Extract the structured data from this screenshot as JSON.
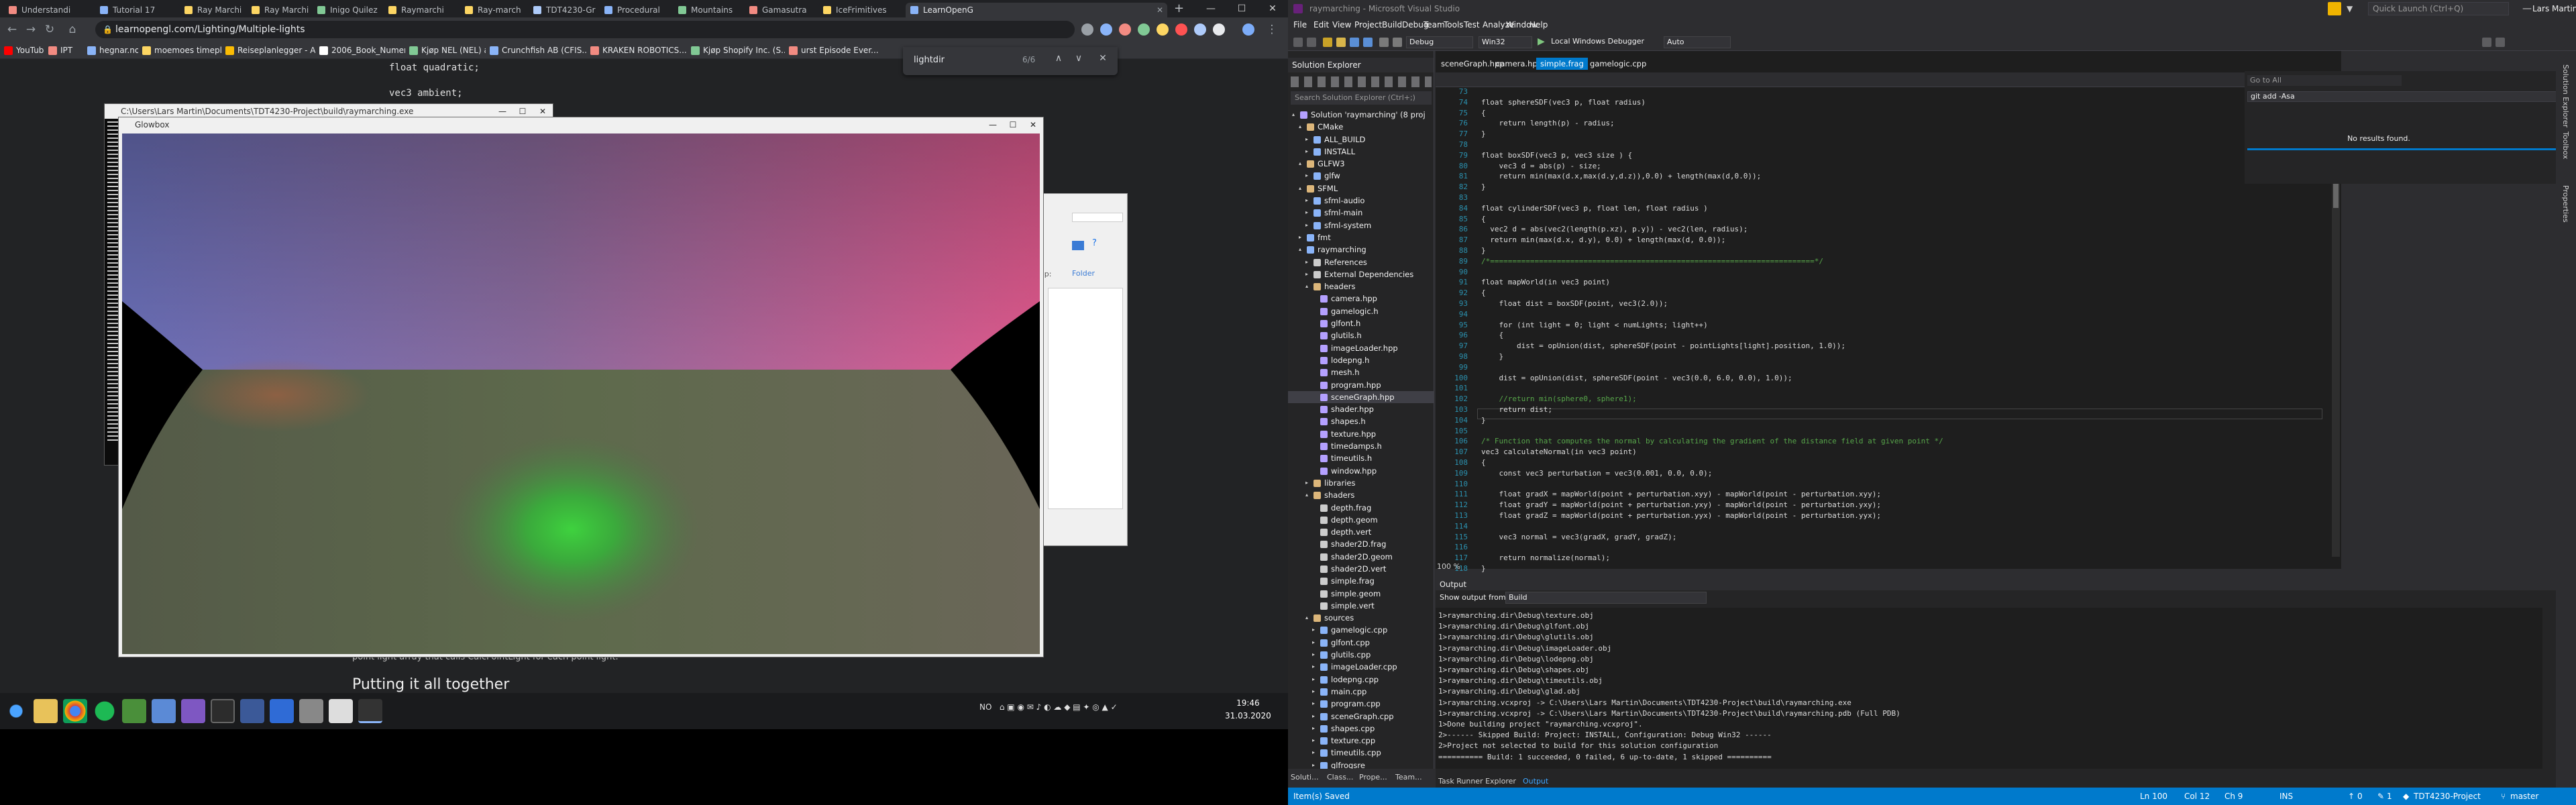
{
  "browser": {
    "tabs": [
      {
        "label": "Understandi",
        "color": "#f28b82"
      },
      {
        "label": "Tutorial 17",
        "color": "#8ab4f8"
      },
      {
        "label": "Ray Marchi",
        "color": "#fdd663"
      },
      {
        "label": "Ray Marchi",
        "color": "#fdd663"
      },
      {
        "label": "Inigo Quilez",
        "color": "#81c995"
      },
      {
        "label": "Raymarchi",
        "color": "#fdd663"
      },
      {
        "label": "Ray-march",
        "color": "#fdd663"
      },
      {
        "label": "TDT4230-Gr",
        "color": "#aecbfa"
      },
      {
        "label": "Procedural",
        "color": "#8ab4f8"
      },
      {
        "label": "Mountains",
        "color": "#81c995"
      },
      {
        "label": "Gamasutra",
        "color": "#f28b82"
      },
      {
        "label": "IceFrimitives",
        "color": "#fdd663"
      },
      {
        "label": "LearnOpenG",
        "color": "#8ab4f8"
      }
    ],
    "new_tab": "+",
    "url": "learnopengl.com/Lighting/Multiple-lights",
    "bookmarks": [
      {
        "label": "YouTube",
        "color": "#ff0000"
      },
      {
        "label": "IPT",
        "color": "#f28b82"
      },
      {
        "label": "hegnar.no",
        "color": "#8ab4f8"
      },
      {
        "label": "moemoes timeplan...",
        "color": "#fdd663"
      },
      {
        "label": "Reiseplanlegger - A...",
        "color": "#fbbc04"
      },
      {
        "label": "2006_Book_Numeri...",
        "color": "#ffffff"
      },
      {
        "label": "Kjøp NEL (NEL) aksj...",
        "color": "#81c995"
      },
      {
        "label": "Crunchfish AB (CFIS...",
        "color": "#8ab4f8"
      },
      {
        "label": "KRAKEN ROBOTICS...",
        "color": "#f28b82"
      },
      {
        "label": "Kjøp Shopify Inc. (S...",
        "color": "#81c995"
      },
      {
        "label": "urst Episode Ever...",
        "color": "#f28b82"
      }
    ],
    "find": {
      "query": "lightdir",
      "count": "6/6"
    },
    "page": {
      "snippet1": "float quadratic;",
      "snippet2": "vec3 ambient;",
      "para": "point light array that calls CalcPointLight for each point light.",
      "heading": "Putting it all together"
    }
  },
  "windows": {
    "console_title": "C:\\Users\\Lars Martin\\Documents\\TDT4230-Project\\build\\raymarching.exe",
    "glfw_title": "Glowbox"
  },
  "explorer": {
    "folder": "Folder"
  },
  "taskbar": {
    "tray_lang": "NO",
    "time": "19:46",
    "date": "31.03.2020"
  },
  "vs": {
    "title": "raymarching - Microsoft Visual Studio",
    "menu": [
      "File",
      "Edit",
      "View",
      "Project",
      "Build",
      "Debug",
      "Team",
      "Tools",
      "Test",
      "Analyze",
      "Window",
      "Help"
    ],
    "toolbar": {
      "config": "Debug",
      "platform": "Win32",
      "debugger": "Local Windows Debugger",
      "mode": "Auto"
    },
    "quick_launch": "Quick Launch (Ctrl+Q)",
    "user": "Lars Martin Moe",
    "solution_explorer": {
      "title": "Solution Explorer",
      "search": "Search Solution Explorer (Ctrl+;)",
      "items": [
        {
          "label": "Solution 'raymarching' (8 proj",
          "indent": 0,
          "arrow": "▴",
          "color": "#b4a0ff"
        },
        {
          "label": "CMake",
          "indent": 1,
          "arrow": "▴",
          "color": "#dcb67a"
        },
        {
          "label": "ALL_BUILD",
          "indent": 2,
          "arrow": "▸",
          "color": "#8ab4f8"
        },
        {
          "label": "INSTALL",
          "indent": 2,
          "arrow": "▸",
          "color": "#8ab4f8"
        },
        {
          "label": "GLFW3",
          "indent": 1,
          "arrow": "▴",
          "color": "#dcb67a"
        },
        {
          "label": "glfw",
          "indent": 2,
          "arrow": "▸",
          "color": "#8ab4f8"
        },
        {
          "label": "SFML",
          "indent": 1,
          "arrow": "▴",
          "color": "#dcb67a"
        },
        {
          "label": "sfml-audio",
          "indent": 2,
          "arrow": "▸",
          "color": "#8ab4f8"
        },
        {
          "label": "sfml-main",
          "indent": 2,
          "arrow": "▸",
          "color": "#8ab4f8"
        },
        {
          "label": "sfml-system",
          "indent": 2,
          "arrow": "▸",
          "color": "#8ab4f8"
        },
        {
          "label": "fmt",
          "indent": 1,
          "arrow": "▸",
          "color": "#8ab4f8"
        },
        {
          "label": "raymarching",
          "indent": 1,
          "arrow": "▴",
          "color": "#8ab4f8"
        },
        {
          "label": "References",
          "indent": 2,
          "arrow": "▸",
          "color": "#cccccc"
        },
        {
          "label": "External Dependencies",
          "indent": 2,
          "arrow": "▸",
          "color": "#cccccc"
        },
        {
          "label": "headers",
          "indent": 2,
          "arrow": "▴",
          "color": "#dcb67a"
        },
        {
          "label": "camera.hpp",
          "indent": 3,
          "arrow": "",
          "color": "#b4a0ff"
        },
        {
          "label": "gamelogic.h",
          "indent": 3,
          "arrow": "",
          "color": "#b4a0ff"
        },
        {
          "label": "glfont.h",
          "indent": 3,
          "arrow": "",
          "color": "#b4a0ff"
        },
        {
          "label": "glutils.h",
          "indent": 3,
          "arrow": "",
          "color": "#b4a0ff"
        },
        {
          "label": "imageLoader.hpp",
          "indent": 3,
          "arrow": "",
          "color": "#b4a0ff"
        },
        {
          "label": "lodepng.h",
          "indent": 3,
          "arrow": "",
          "color": "#b4a0ff"
        },
        {
          "label": "mesh.h",
          "indent": 3,
          "arrow": "",
          "color": "#b4a0ff"
        },
        {
          "label": "program.hpp",
          "indent": 3,
          "arrow": "",
          "color": "#b4a0ff"
        },
        {
          "label": "sceneGraph.hpp",
          "indent": 3,
          "arrow": "",
          "color": "#b4a0ff",
          "selected": true
        },
        {
          "label": "shader.hpp",
          "indent": 3,
          "arrow": "",
          "color": "#b4a0ff"
        },
        {
          "label": "shapes.h",
          "indent": 3,
          "arrow": "",
          "color": "#b4a0ff"
        },
        {
          "label": "texture.hpp",
          "indent": 3,
          "arrow": "",
          "color": "#b4a0ff"
        },
        {
          "label": "timedamps.h",
          "indent": 3,
          "arrow": "",
          "color": "#b4a0ff"
        },
        {
          "label": "timeutils.h",
          "indent": 3,
          "arrow": "",
          "color": "#b4a0ff"
        },
        {
          "label": "window.hpp",
          "indent": 3,
          "arrow": "",
          "color": "#b4a0ff"
        },
        {
          "label": "libraries",
          "indent": 2,
          "arrow": "▸",
          "color": "#dcb67a"
        },
        {
          "label": "shaders",
          "indent": 2,
          "arrow": "▴",
          "color": "#dcb67a"
        },
        {
          "label": "depth.frag",
          "indent": 3,
          "arrow": "",
          "color": "#cccccc"
        },
        {
          "label": "depth.geom",
          "indent": 3,
          "arrow": "",
          "color": "#cccccc"
        },
        {
          "label": "depth.vert",
          "indent": 3,
          "arrow": "",
          "color": "#cccccc"
        },
        {
          "label": "shader2D.frag",
          "indent": 3,
          "arrow": "",
          "color": "#cccccc"
        },
        {
          "label": "shader2D.geom",
          "indent": 3,
          "arrow": "",
          "color": "#cccccc"
        },
        {
          "label": "shader2D.vert",
          "indent": 3,
          "arrow": "",
          "color": "#cccccc"
        },
        {
          "label": "simple.frag",
          "indent": 3,
          "arrow": "",
          "color": "#cccccc"
        },
        {
          "label": "simple.geom",
          "indent": 3,
          "arrow": "",
          "color": "#cccccc"
        },
        {
          "label": "simple.vert",
          "indent": 3,
          "arrow": "",
          "color": "#cccccc"
        },
        {
          "label": "sources",
          "indent": 2,
          "arrow": "▴",
          "color": "#dcb67a"
        },
        {
          "label": "gamelogic.cpp",
          "indent": 3,
          "arrow": "▸",
          "color": "#8ab4f8"
        },
        {
          "label": "glfont.cpp",
          "indent": 3,
          "arrow": "▸",
          "color": "#8ab4f8"
        },
        {
          "label": "glutils.cpp",
          "indent": 3,
          "arrow": "▸",
          "color": "#8ab4f8"
        },
        {
          "label": "imageLoader.cpp",
          "indent": 3,
          "arrow": "▸",
          "color": "#8ab4f8"
        },
        {
          "label": "lodepng.cpp",
          "indent": 3,
          "arrow": "▸",
          "color": "#8ab4f8"
        },
        {
          "label": "main.cpp",
          "indent": 3,
          "arrow": "▸",
          "color": "#8ab4f8"
        },
        {
          "label": "program.cpp",
          "indent": 3,
          "arrow": "▸",
          "color": "#8ab4f8"
        },
        {
          "label": "sceneGraph.cpp",
          "indent": 3,
          "arrow": "▸",
          "color": "#8ab4f8"
        },
        {
          "label": "shapes.cpp",
          "indent": 3,
          "arrow": "▸",
          "color": "#8ab4f8"
        },
        {
          "label": "texture.cpp",
          "indent": 3,
          "arrow": "▸",
          "color": "#8ab4f8"
        },
        {
          "label": "timeutils.cpp",
          "indent": 3,
          "arrow": "▸",
          "color": "#8ab4f8"
        },
        {
          "label": "glfrogsre",
          "indent": 3,
          "arrow": "▸",
          "color": "#8ab4f8"
        }
      ],
      "bottom_tabs": [
        "Soluti...",
        "Class...",
        "Prope...",
        "Team..."
      ]
    },
    "editor": {
      "tabs": [
        {
          "label": "sceneGraph.hpp",
          "active": false
        },
        {
          "label": "camera.hpp",
          "active": false
        },
        {
          "label": "simple.frag",
          "active": true
        },
        {
          "label": "gamelogic.cpp",
          "active": false
        }
      ],
      "lines": [
        {
          "n": "73",
          "t": ""
        },
        {
          "n": "74",
          "t": "float sphereSDF(vec3 p, float radius)"
        },
        {
          "n": "75",
          "t": "{"
        },
        {
          "n": "76",
          "t": "    return length(p) - radius;"
        },
        {
          "n": "77",
          "t": "}"
        },
        {
          "n": "78",
          "t": ""
        },
        {
          "n": "79",
          "t": "float boxSDF(vec3 p, vec3 size ) {"
        },
        {
          "n": "80",
          "t": "    vec3 d = abs(p) - size;"
        },
        {
          "n": "81",
          "t": "    return min(max(d.x,max(d.y,d.z)),0.0) + length(max(d,0.0));"
        },
        {
          "n": "82",
          "t": "}"
        },
        {
          "n": "83",
          "t": ""
        },
        {
          "n": "84",
          "t": "float cylinderSDF(vec3 p, float len, float radius )"
        },
        {
          "n": "85",
          "t": "{"
        },
        {
          "n": "86",
          "t": "  vec2 d = abs(vec2(length(p.xz), p.y)) - vec2(len, radius);"
        },
        {
          "n": "87",
          "t": "  return min(max(d.x, d.y), 0.0) + length(max(d, 0.0));"
        },
        {
          "n": "88",
          "t": "}"
        },
        {
          "n": "89",
          "t": "/*=========================================================================*/"
        },
        {
          "n": "90",
          "t": ""
        },
        {
          "n": "91",
          "t": "float mapWorld(in vec3 point)"
        },
        {
          "n": "92",
          "t": "{"
        },
        {
          "n": "93",
          "t": "    float dist = boxSDF(point, vec3(2.0));"
        },
        {
          "n": "94",
          "t": ""
        },
        {
          "n": "95",
          "t": "    for (int light = 0; light < numLights; light++)"
        },
        {
          "n": "96",
          "t": "    {"
        },
        {
          "n": "97",
          "t": "        dist = opUnion(dist, sphereSDF(point - pointLights[light].position, 1.0));"
        },
        {
          "n": "98",
          "t": "    }"
        },
        {
          "n": "99",
          "t": ""
        },
        {
          "n": "100",
          "t": "    dist = opUnion(dist, sphereSDF(point - vec3(0.0, 6.0, 0.0), 1.0));"
        },
        {
          "n": "101",
          "t": ""
        },
        {
          "n": "102",
          "t": "    //return min(sphere0, sphere1);"
        },
        {
          "n": "103",
          "t": "    return dist;"
        },
        {
          "n": "104",
          "t": "}"
        },
        {
          "n": "105",
          "t": ""
        },
        {
          "n": "106",
          "t": "/* Function that computes the normal by calculating the gradient of the distance field at given point */"
        },
        {
          "n": "107",
          "t": "vec3 calculateNormal(in vec3 point)"
        },
        {
          "n": "108",
          "t": "{"
        },
        {
          "n": "109",
          "t": "    const vec3 perturbation = vec3(0.001, 0.0, 0.0);"
        },
        {
          "n": "110",
          "t": ""
        },
        {
          "n": "111",
          "t": "    float gradX = mapWorld(point + perturbation.xyy) - mapWorld(point - perturbation.xyy);"
        },
        {
          "n": "112",
          "t": "    float gradY = mapWorld(point + perturbation.yxy) - mapWorld(point - perturbation.yxy);"
        },
        {
          "n": "113",
          "t": "    float gradZ = mapWorld(point + perturbation.yyx) - mapWorld(point - perturbation.yyx);"
        },
        {
          "n": "114",
          "t": ""
        },
        {
          "n": "115",
          "t": "    vec3 normal = vec3(gradX, gradY, gradZ);"
        },
        {
          "n": "116",
          "t": ""
        },
        {
          "n": "117",
          "t": "    return normalize(normal);"
        },
        {
          "n": "118",
          "t": "}"
        }
      ],
      "zoom": "100 %"
    },
    "git": {
      "go_to_all": "Go to All",
      "input": "git add -Asa",
      "no_results": "No results found."
    },
    "right_tabs": [
      "Solution Explorer",
      "Toolbox",
      "Properties"
    ],
    "output": {
      "title": "Output",
      "show_from_label": "Show output from:",
      "show_from_value": "Build",
      "lines": [
        "1>raymarching.dir\\Debug\\texture.obj",
        "1>raymarching.dir\\Debug\\glfont.obj",
        "1>raymarching.dir\\Debug\\glutils.obj",
        "1>raymarching.dir\\Debug\\imageLoader.obj",
        "1>raymarching.dir\\Debug\\lodepng.obj",
        "1>raymarching.dir\\Debug\\shapes.obj",
        "1>raymarching.dir\\Debug\\timeutils.obj",
        "1>raymarching.dir\\Debug\\glad.obj",
        "1>raymarching.vcxproj -> C:\\Users\\Lars Martin\\Documents\\TDT4230-Project\\build\\raymarching.exe",
        "1>raymarching.vcxproj -> C:\\Users\\Lars Martin\\Documents\\TDT4230-Project\\build\\raymarching.pdb (Full PDB)",
        "1>Done building project \"raymarching.vcxproj\".",
        "2>------ Skipped Build: Project: INSTALL, Configuration: Debug Win32 ------",
        "2>Project not selected to build for this solution configuration",
        "========== Build: 1 succeeded, 0 failed, 6 up-to-date, 1 skipped =========="
      ],
      "tabs": [
        "Task Runner Explorer",
        "Output"
      ]
    },
    "status": {
      "left": "Item(s) Saved",
      "ln": "Ln 100",
      "col": "Col 12",
      "ch": "Ch 9",
      "ins": "INS",
      "up": "0",
      "pencil": "1",
      "repo": "TDT4230-Project",
      "branch": "master"
    }
  }
}
